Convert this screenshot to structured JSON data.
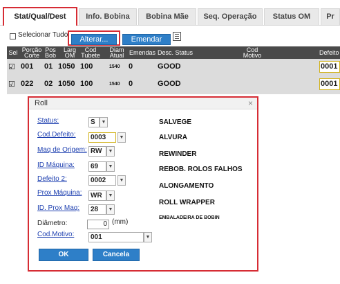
{
  "tabs": [
    {
      "label": "Stat/Qual/Dest",
      "active": true
    },
    {
      "label": "Info. Bobina"
    },
    {
      "label": "Bobina Mãe"
    },
    {
      "label": "Seq. Operação"
    },
    {
      "label": "Status OM"
    },
    {
      "label": "Pr"
    }
  ],
  "toolbar": {
    "select_all_label": "Selecionar Tudo",
    "alterar_label": "Alterar...",
    "emendar_label": "Emendar"
  },
  "grid": {
    "columns": [
      {
        "label": "Sel"
      },
      {
        "label": "Porção Corte"
      },
      {
        "label": "Pos Bob"
      },
      {
        "label": "Larg OM"
      },
      {
        "label": "Cod Tubete"
      },
      {
        "label": "Diam Atual"
      },
      {
        "label": "Emendas"
      },
      {
        "label": "Desc. Status"
      },
      {
        "label": "Cod Motivo"
      },
      {
        "label": "Defeito"
      }
    ],
    "rows": [
      {
        "checked": "☑",
        "porcao": "001",
        "pos": "01",
        "larg": "1050",
        "tubete": "100",
        "diam": "1540",
        "emendas": "0",
        "status": "GOOD",
        "defeito": "0001"
      },
      {
        "checked": "☑",
        "porcao": "022",
        "pos": "02",
        "larg": "1050",
        "tubete": "100",
        "diam": "1540",
        "emendas": "0",
        "status": "GOOD",
        "defeito": "0001"
      }
    ]
  },
  "dialog": {
    "title": "Roll",
    "close_glyph": "×",
    "fields": {
      "status": {
        "label": "Status:",
        "value": "S",
        "desc": "SALVEGE"
      },
      "cod_defeito": {
        "label": "Cod.Defeito:",
        "value": "0003",
        "desc": "ALVURA"
      },
      "maq_origem": {
        "label": "Maq de Origem:",
        "value": "RW",
        "desc": "REWINDER"
      },
      "id_maquina": {
        "label": "ID Máquina:",
        "value": "69",
        "desc": "REBOB. ROLOS FALHOS"
      },
      "defeito2": {
        "label": "Defeito 2:",
        "value": "0002",
        "desc": "ALONGAMENTO"
      },
      "prox_maquina": {
        "label": "Prox Máquina:",
        "value": "WR",
        "desc": "ROLL WRAPPER"
      },
      "id_prox_maq": {
        "label": "ID. Prox Maq:",
        "value": "28",
        "desc": "EMBALADEIRA DE BOBIN"
      },
      "diametro": {
        "label": "Diâmetro:",
        "value": "0",
        "unit": "(mm)"
      },
      "cod_motivo": {
        "label": "Cod.Motivo:",
        "value": "001"
      }
    },
    "ok_label": "OK",
    "cancel_label": "Cancela"
  },
  "icons": {
    "dropdown": "▼",
    "export": "excel-export-icon"
  },
  "colors": {
    "accent_blue": "#2e7fc8",
    "highlight_red": "#d62c34",
    "grid_header": "#4a4a4a",
    "row_bg": "#dcdcdc",
    "defeito_border": "#d1b21b"
  }
}
